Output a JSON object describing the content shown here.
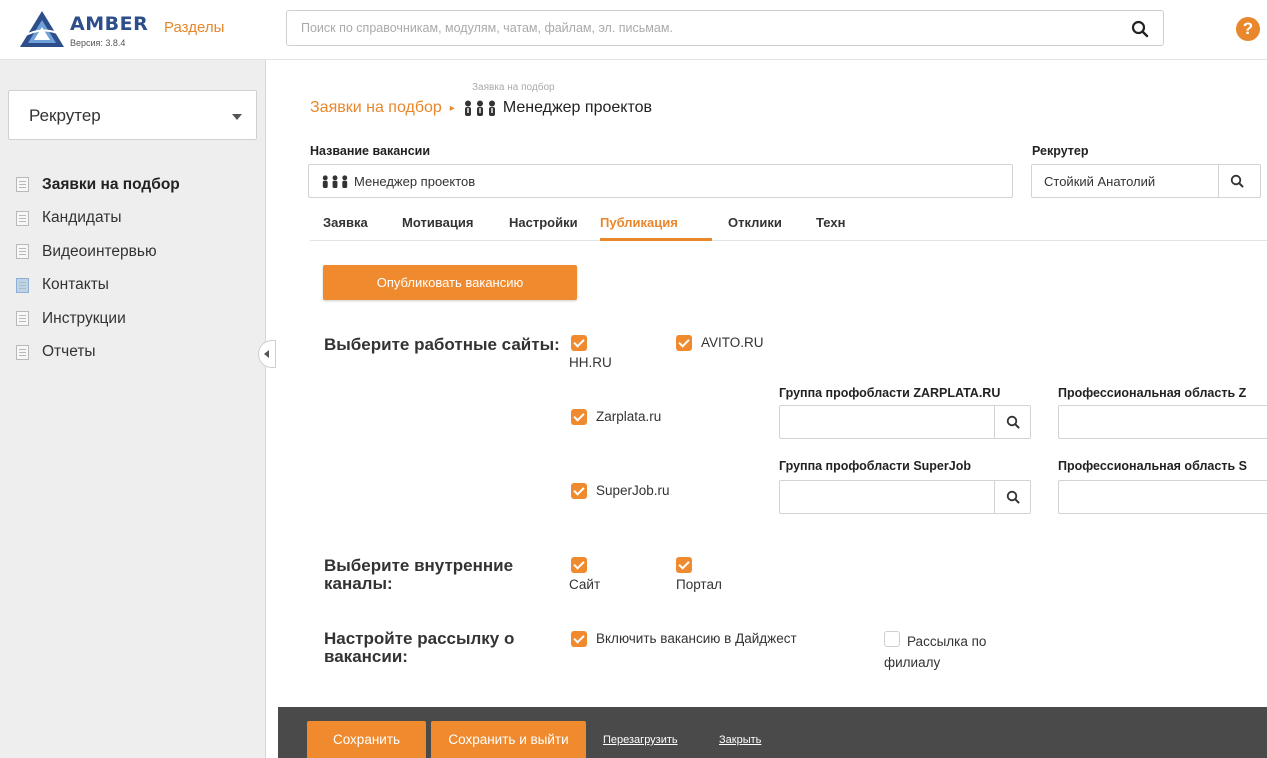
{
  "app": {
    "logo_text": "AMBER",
    "version": "Версия: 3.8.4",
    "sections_label": "Разделы",
    "help_glyph": "?"
  },
  "search": {
    "placeholder": "Поиск по справочникам, модулям, чатам, файлам, эл. письмам."
  },
  "sidebar": {
    "role": "Рекрутер",
    "items": [
      {
        "label": "Заявки на подбор",
        "icon": "document-icon",
        "active": true
      },
      {
        "label": "Кандидаты",
        "icon": "document-icon"
      },
      {
        "label": "Видеоинтервью",
        "icon": "document-icon"
      },
      {
        "label": "Контакты",
        "icon": "contacts-icon"
      },
      {
        "label": "Инструкции",
        "icon": "document-icon"
      },
      {
        "label": "Отчеты",
        "icon": "document-icon"
      }
    ]
  },
  "breadcrumb": {
    "small": "Заявка на подбор",
    "link": "Заявки на подбор",
    "current": "Менеджер проектов"
  },
  "form": {
    "vacancy_name_label": "Название вакансии",
    "vacancy_name_value": "Менеджер проектов",
    "recruiter_label": "Рекрутер",
    "recruiter_value": "Стойкий Анатолий"
  },
  "tabs": [
    {
      "label": "Заявка"
    },
    {
      "label": "Мотивация"
    },
    {
      "label": "Настройки"
    },
    {
      "label": "Публикация",
      "active": true
    },
    {
      "label": "Отклики"
    },
    {
      "label": "Техн"
    }
  ],
  "publication": {
    "publish_button": "Опубликовать вакансию",
    "job_sites_title": "Выберите работные сайты:",
    "sites": {
      "hh": {
        "label": "HH.RU",
        "checked": true
      },
      "avito": {
        "label": "AVITO.RU",
        "checked": true
      },
      "zarplata": {
        "label": "Zarplata.ru",
        "checked": true
      },
      "superjob": {
        "label": "SuperJob.ru",
        "checked": true
      }
    },
    "zarplata_group_label": "Группа профобласти ZARPLATA.RU",
    "zarplata_prof_label": "Профессиональная область Z",
    "superjob_group_label": "Группа профобласти SuperJob",
    "superjob_prof_label": "Профессиональная область S",
    "internal_title": "Выберите внутренние каналы:",
    "internal": {
      "site": {
        "label": "Сайт",
        "checked": true
      },
      "portal": {
        "label": "Портал",
        "checked": true
      }
    },
    "mailing_title": "Настройте рассылку о вакансии:",
    "mailing": {
      "digest": {
        "label": "Включить вакансию в Дайджест",
        "checked": true
      },
      "branch": {
        "label": "Рассылка по филиалу",
        "checked": false
      }
    }
  },
  "footer": {
    "save": "Сохранить",
    "save_exit": "Сохранить и выйти",
    "reload": "Перезагрузить",
    "close": "Закрыть"
  },
  "colors": {
    "accent": "#ef8a2e",
    "brand": "#2d4e8a",
    "footer_bg": "#4a4a4a"
  }
}
